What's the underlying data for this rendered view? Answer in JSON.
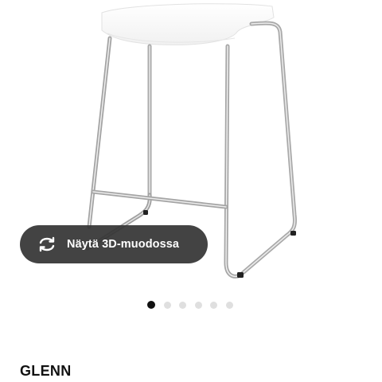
{
  "product": {
    "name": "GLENN"
  },
  "viewer": {
    "view_3d_label": "Näytä 3D-muodossa",
    "view_3d_icon": "rotate-3d-icon"
  },
  "carousel": {
    "active_index": 0,
    "dots": [
      {
        "state": "active"
      },
      {
        "state": "inactive"
      },
      {
        "state": "inactive"
      },
      {
        "state": "inactive"
      },
      {
        "state": "inactive"
      },
      {
        "state": "inactive"
      }
    ]
  },
  "colors": {
    "button_background": "#333333",
    "button_text": "#ffffff",
    "dot_active": "#111111",
    "dot_inactive": "#dfdfdf",
    "chrome": "#b9b9b9",
    "seat": "#ffffff"
  }
}
